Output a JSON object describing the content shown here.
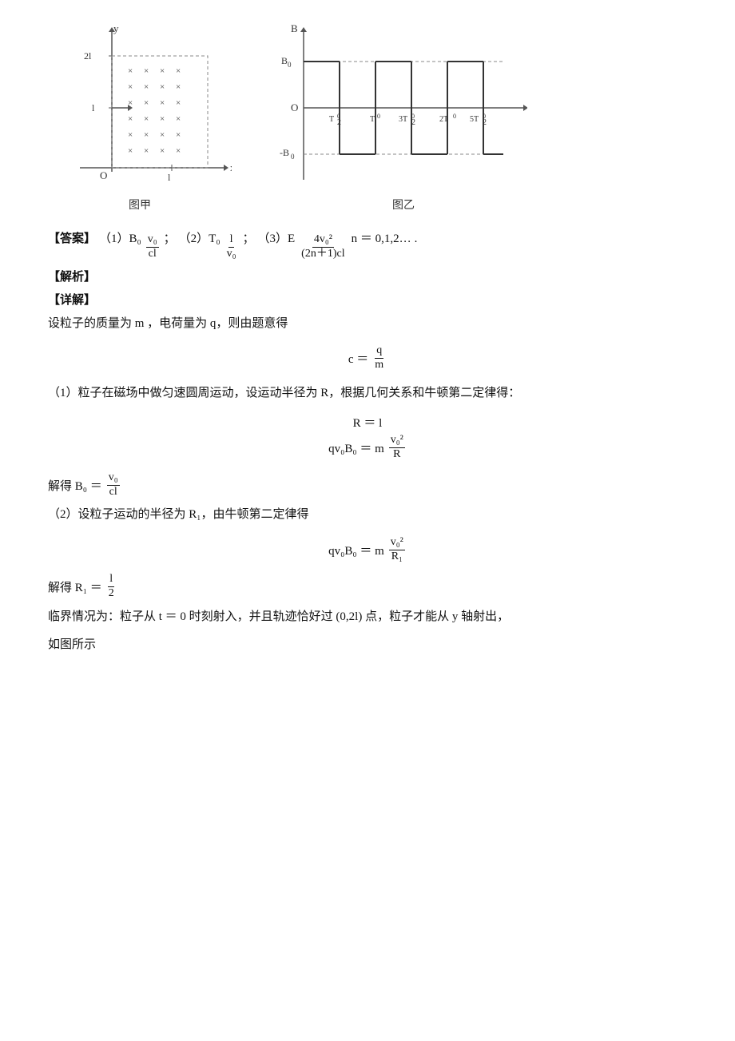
{
  "diagrams": {
    "left_label": "图甲",
    "right_label": "图乙"
  },
  "answer": {
    "label": "【答案】",
    "parts": [
      {
        "num": "（1）",
        "var": "B₀",
        "eq": "v₀/cl"
      },
      {
        "num": "（2）",
        "var": "T₀",
        "eq": "l/v₀"
      },
      {
        "num": "（3）",
        "var": "E",
        "eq": "4v₀²/(2n+1)cl",
        "suffix": "n 0,1,2L"
      }
    ]
  },
  "analysis": {
    "label1": "【解析】",
    "label2": "【详解】",
    "intro": "设粒子的质量为  m ，电荷量为 q，则由题意得",
    "c_eq": "c  =  q/m",
    "part1": {
      "desc": "（1）粒子在磁场中做匀速圆周运动，设运动半径为 R，根据几何关系和牛顿第二定律得：",
      "eq1": "R ＝ l",
      "eq2": "qv₀B₀ ＝ mv₀²/R",
      "solve": "解得 B₀ ＝ v₀/(cl)"
    },
    "part2": {
      "desc": "（2）设粒子运动的半径为  R₁，由牛顿第二定律得",
      "eq1": "qv₀B₀ ＝ mv₀²/R₁",
      "solve": "解得 R₁ ＝ l/2",
      "boundary": "临界情况为：粒子从  t ＝ 0 时刻射入，并且轨迹恰好过  (0,2l) 点，粒子才能从  y 轴射出，",
      "boundary2": "如图所示"
    }
  }
}
